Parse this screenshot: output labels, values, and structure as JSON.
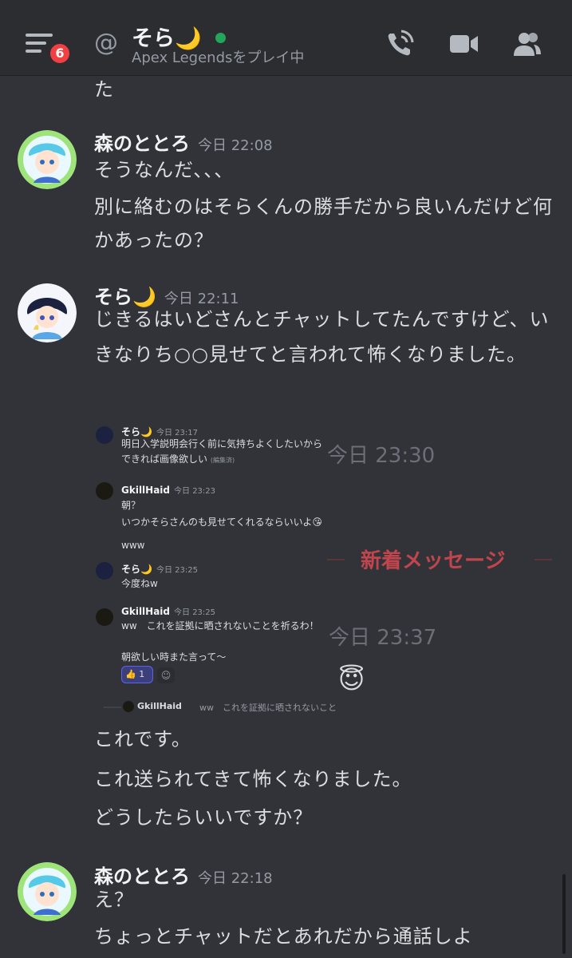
{
  "header": {
    "notification_count": "6",
    "channel_name": "そら🌙",
    "status_game": "Apex Legends",
    "status_suffix": "をプレイ中"
  },
  "top_fragment": "た",
  "messages": [
    {
      "author": "森のととろ",
      "timestamp": "今日 22:08",
      "lines": [
        "そうなんだ、、、",
        "別に絡むのはそらくんの勝手だから良いんだけど何かあったの？"
      ]
    },
    {
      "author": "そら🌙",
      "timestamp": "今日 22:11",
      "lines": [
        "じきるはいどさんとチャットしてたんですけど、いきなりち○○見せてと言われて怖くなりました。"
      ]
    },
    {
      "author": "",
      "timestamp": "",
      "lines": [
        "これです。",
        "これ送られてきて怖くなりました。",
        "どうしたらいいですか？"
      ]
    },
    {
      "author": "森のととろ",
      "timestamp": "今日 22:18",
      "lines": [
        "え？",
        "ちょっとチャットだとあれだから通話しよ"
      ]
    }
  ],
  "screenshot": {
    "messages": [
      {
        "author": "そら🌙",
        "timestamp": "今日 23:17",
        "text": "明日入学説明会行く前に気持ちよくしたいからできれば画像欲しい",
        "edited": "(編集済)"
      },
      {
        "author": "GkillHaid",
        "timestamp": "今日 23:23",
        "text": "朝？",
        "text2": "いつかそらさんのも見せてくれるならいいよ😘 www"
      },
      {
        "author": "そら🌙",
        "timestamp": "今日 23:25",
        "text": "今度ねw"
      },
      {
        "author": "GkillHaid",
        "timestamp": "今日 23:25",
        "text": "ww　これを証拠に晒されないことを祈るわ！",
        "text2": "朝欲しい時また言って〜"
      }
    ],
    "divider_time_1": "今日 23:30",
    "new_messages_label": "新着メッセージ",
    "divider_time_2": "今日 23:37",
    "reaction_emoji": "👍",
    "reaction_count": "1",
    "big_emoji": "😇",
    "reply_author": "GkillHaid",
    "reply_text": "ww　これを証拠に晒されないこと"
  },
  "colors": {
    "background": "#313338",
    "header": "#2b2d31",
    "online": "#23a55a",
    "badge": "#f23f43",
    "new_messages": "#c0454c"
  },
  "icons": [
    "hamburger-icon",
    "at-icon",
    "phone-call-icon",
    "video-camera-icon",
    "members-icon",
    "add-reaction-icon"
  ]
}
